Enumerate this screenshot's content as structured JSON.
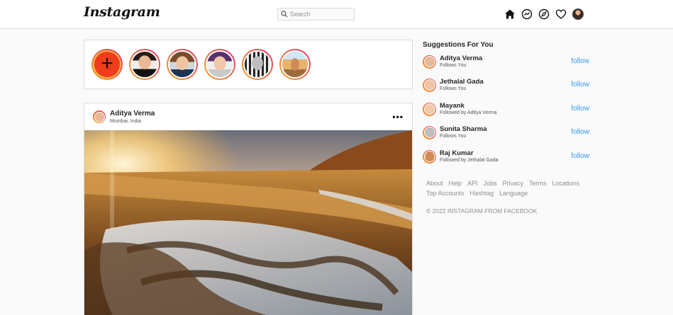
{
  "app": {
    "logo": "Instagram"
  },
  "search": {
    "placeholder": "Search"
  },
  "nav": {
    "icons": [
      "home-icon",
      "messenger-icon",
      "explore-icon",
      "heart-icon",
      "profile-avatar"
    ]
  },
  "stories": {
    "count": 6,
    "add_icon": "plus-icon"
  },
  "post": {
    "username": "Aditya Verma",
    "location": "Mumbai, India",
    "more_label": "•••"
  },
  "suggestions": {
    "title": "Suggestions For You",
    "items": [
      {
        "name": "Aditya Verma",
        "sub": "Follows You",
        "action": "follow"
      },
      {
        "name": "Jethalal Gada",
        "sub": "Follows You",
        "action": "follow"
      },
      {
        "name": "Mayank",
        "sub": "Followed by Aditya Verma",
        "action": "follow"
      },
      {
        "name": "Sunita Sharma",
        "sub": "Follows You",
        "action": "follow"
      },
      {
        "name": "Raj Kumar",
        "sub": "Followed by Jethalal Gada",
        "action": "follow"
      }
    ]
  },
  "footer": {
    "links": [
      "About",
      "Help",
      "API",
      "Jobs",
      "Privacy",
      "Terms",
      "Locations",
      "Top Accounts",
      "Hashtag",
      "Language"
    ],
    "copyright": "© 2022 INSTAGRAM FROM FACEBOOK"
  },
  "colors": {
    "link_blue": "#3897f0",
    "story_ring_start": "#f9a825",
    "story_ring_end": "#e1306c",
    "border": "#dbdbdb",
    "background": "#fafafa"
  }
}
